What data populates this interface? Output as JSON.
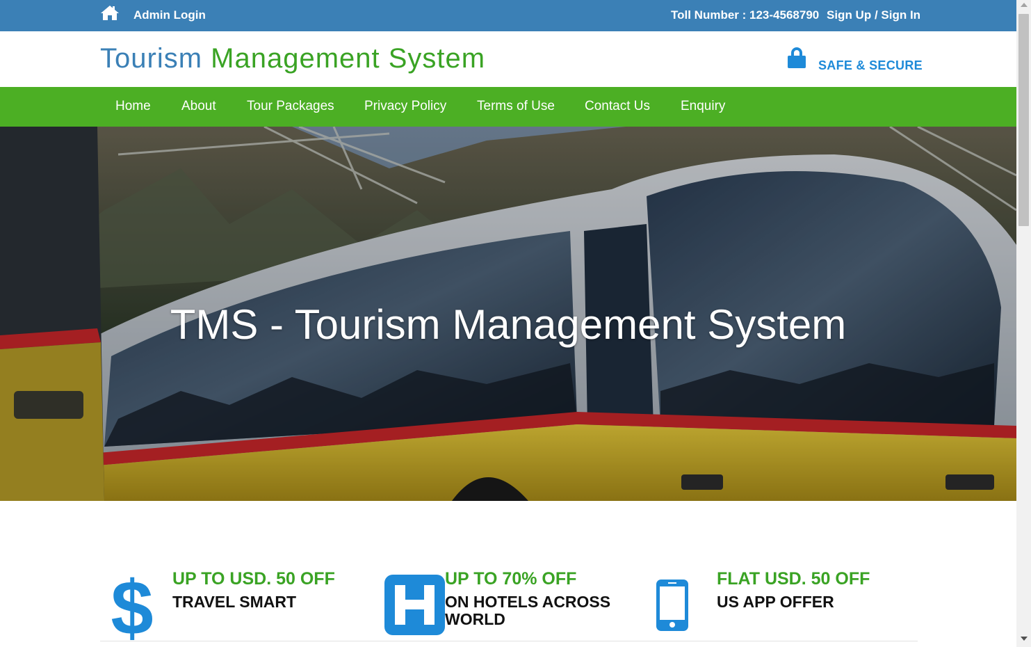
{
  "topbar": {
    "admin_login": "Admin Login",
    "toll": "Toll Number : 123-4568790",
    "signup": "Sign Up / Sign In"
  },
  "header": {
    "logo_part1": "Tourism",
    "logo_part2": "Management System",
    "secure": "SAFE & SECURE"
  },
  "nav": {
    "items": [
      {
        "label": "Home"
      },
      {
        "label": "About"
      },
      {
        "label": "Tour Packages"
      },
      {
        "label": "Privacy Policy"
      },
      {
        "label": "Terms of Use"
      },
      {
        "label": "Contact Us"
      },
      {
        "label": "Enquiry"
      }
    ]
  },
  "hero": {
    "title": "TMS - Tourism Management System"
  },
  "offers": [
    {
      "icon": "dollar-icon",
      "headline": "UP TO USD. 50 OFF",
      "subline": "TRAVEL SMART"
    },
    {
      "icon": "hotel-icon",
      "headline": "UP TO 70% OFF",
      "subline": "ON HOTELS ACROSS WORLD"
    },
    {
      "icon": "mobile-icon",
      "headline": "FLAT USD. 50 OFF",
      "subline": "US APP OFFER"
    }
  ],
  "colors": {
    "topbar": "#3b80b6",
    "nav": "#4caf24",
    "accent_green": "#3aa324",
    "accent_blue": "#1e8ad8"
  }
}
